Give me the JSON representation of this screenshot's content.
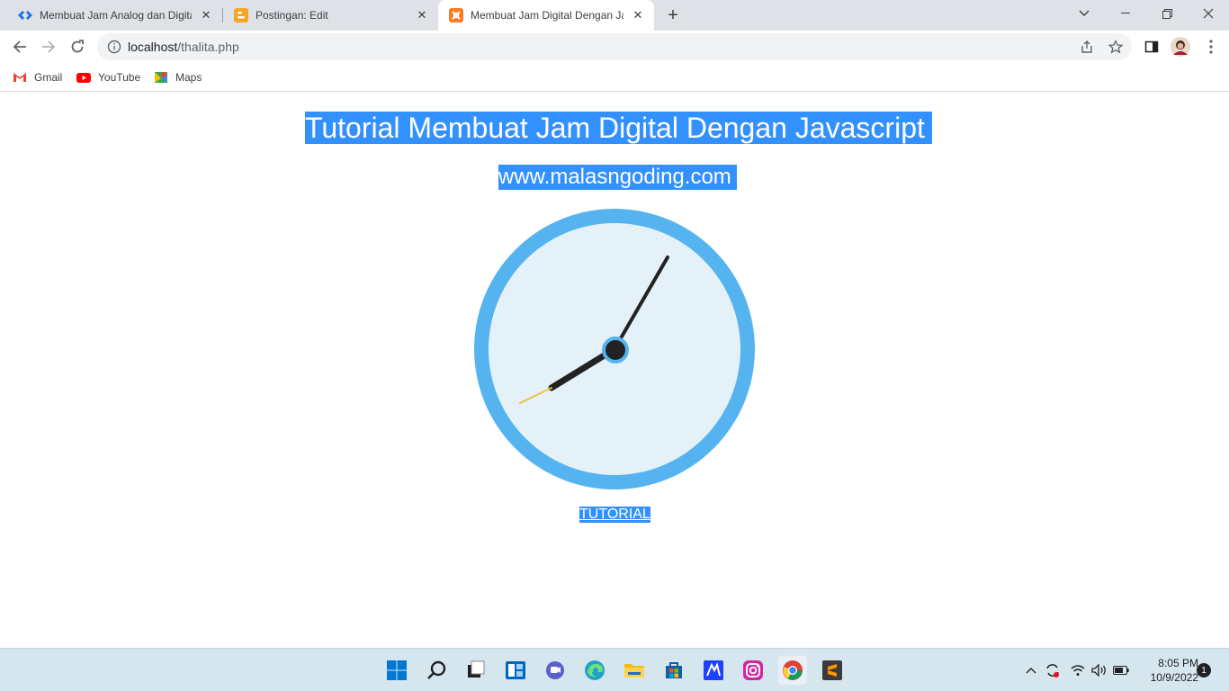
{
  "browser": {
    "tabs": [
      {
        "title": "Membuat Jam Analog dan Digital",
        "favicon": "code-diamond-icon",
        "active": false
      },
      {
        "title": "Postingan: Edit",
        "favicon": "blogger-icon",
        "active": false
      },
      {
        "title": "Membuat Jam Digital Dengan Javascript",
        "favicon": "xampp-icon",
        "active": true
      }
    ],
    "url_host": "localhost",
    "url_path": "/thalita.php",
    "bookmarks": [
      {
        "label": "Gmail",
        "icon": "gmail-icon"
      },
      {
        "label": "YouTube",
        "icon": "youtube-icon"
      },
      {
        "label": "Maps",
        "icon": "maps-icon"
      }
    ]
  },
  "page": {
    "title": "Tutorial Membuat Jam Digital Dengan Javascript",
    "subtitle": "www.malasngoding.com",
    "clock": {
      "hour_hand": "8:05",
      "minute_hand": "5",
      "second_hand": "40",
      "ring_color": "#55b4f0",
      "face_color": "#e4f1f8",
      "hand_color": "#222222",
      "second_color": "#f0c040"
    },
    "link": "TUTORIAL",
    "selection_color": "#3390ff"
  },
  "taskbar": {
    "time": "8:05 PM",
    "date": "10/9/2022",
    "notifications": "1"
  }
}
